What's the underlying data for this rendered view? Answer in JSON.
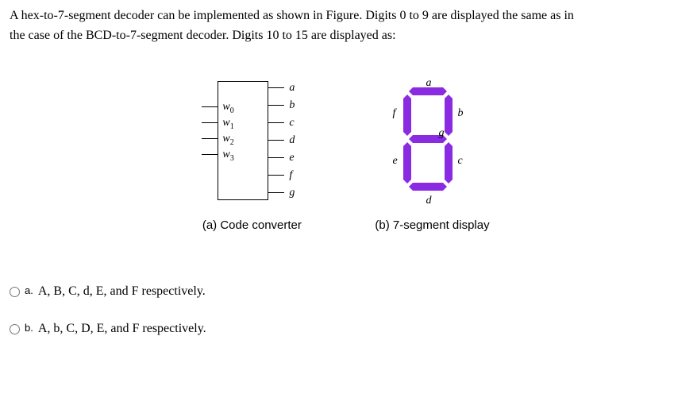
{
  "question": {
    "line1": "A hex-to-7-segment decoder can be implemented as shown in Figure. Digits 0 to 9 are displayed the same as in",
    "line2": "the case of the BCD-to-7-segment decoder. Digits 10 to 15 are displayed as:"
  },
  "figure": {
    "converter": {
      "inputs": [
        "w",
        "w",
        "w",
        "w"
      ],
      "input_subs": [
        "0",
        "1",
        "2",
        "3"
      ],
      "outputs": [
        "a",
        "b",
        "c",
        "d",
        "e",
        "f",
        "g"
      ],
      "caption": "(a) Code converter"
    },
    "display": {
      "labels": {
        "a": "a",
        "b": "b",
        "c": "c",
        "d": "d",
        "e": "e",
        "f": "f",
        "g": "g"
      },
      "caption": "(b) 7-segment display"
    }
  },
  "options": {
    "a": {
      "letter": "a.",
      "text": "A, B, C, d, E, and F respectively."
    },
    "b": {
      "letter": "b.",
      "text": "A, b, C, D, E, and F respectively."
    }
  }
}
